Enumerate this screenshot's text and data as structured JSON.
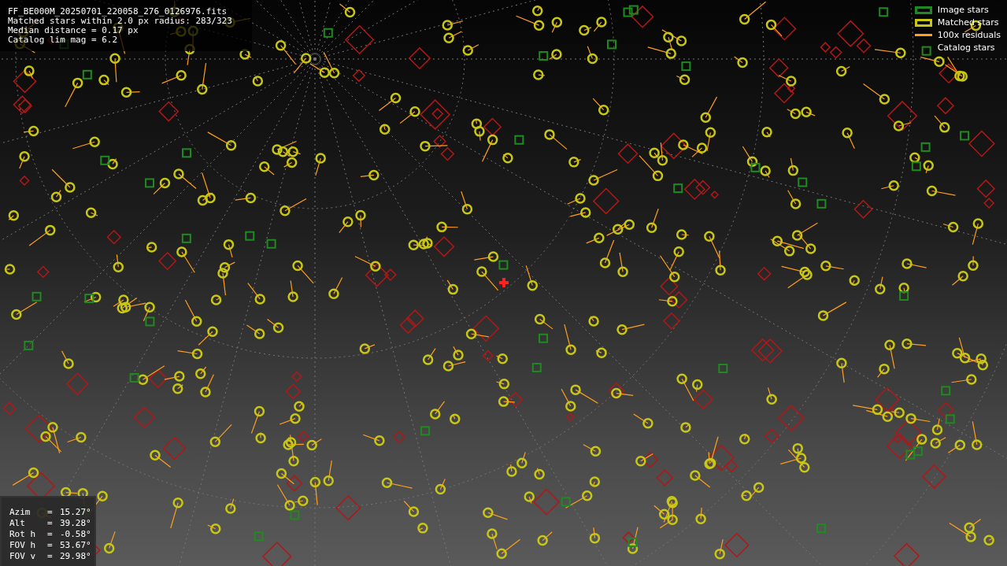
{
  "info": {
    "lines": [
      "FF_BE000M_20250701_220058_276_0126976.fits",
      "Matched stars within 2.0 px radius: 283/323",
      "Median distance = 0.17 px",
      "Catalog lim mag = 6.2"
    ]
  },
  "legend": [
    {
      "kind": "image",
      "label": "Image stars",
      "color": "#1f8a1f"
    },
    {
      "kind": "matched",
      "label": "Matched stars",
      "color": "#c8c814"
    },
    {
      "kind": "residual",
      "label": "100x residuals",
      "color": "#ff9f1c"
    },
    {
      "kind": "catalog",
      "label": "Catalog stars"
    }
  ],
  "pointing": [
    {
      "name": "Azim",
      "sign": "=",
      "value": "15.27°"
    },
    {
      "name": "Alt",
      "sign": "=",
      "value": "39.28°"
    },
    {
      "name": "Rot h",
      "sign": "=",
      "value": "-0.58°"
    },
    {
      "name": "FOV h",
      "sign": "=",
      "value": "53.67°"
    },
    {
      "name": "FOV v",
      "sign": "=",
      "value": "29.98°"
    }
  ]
}
